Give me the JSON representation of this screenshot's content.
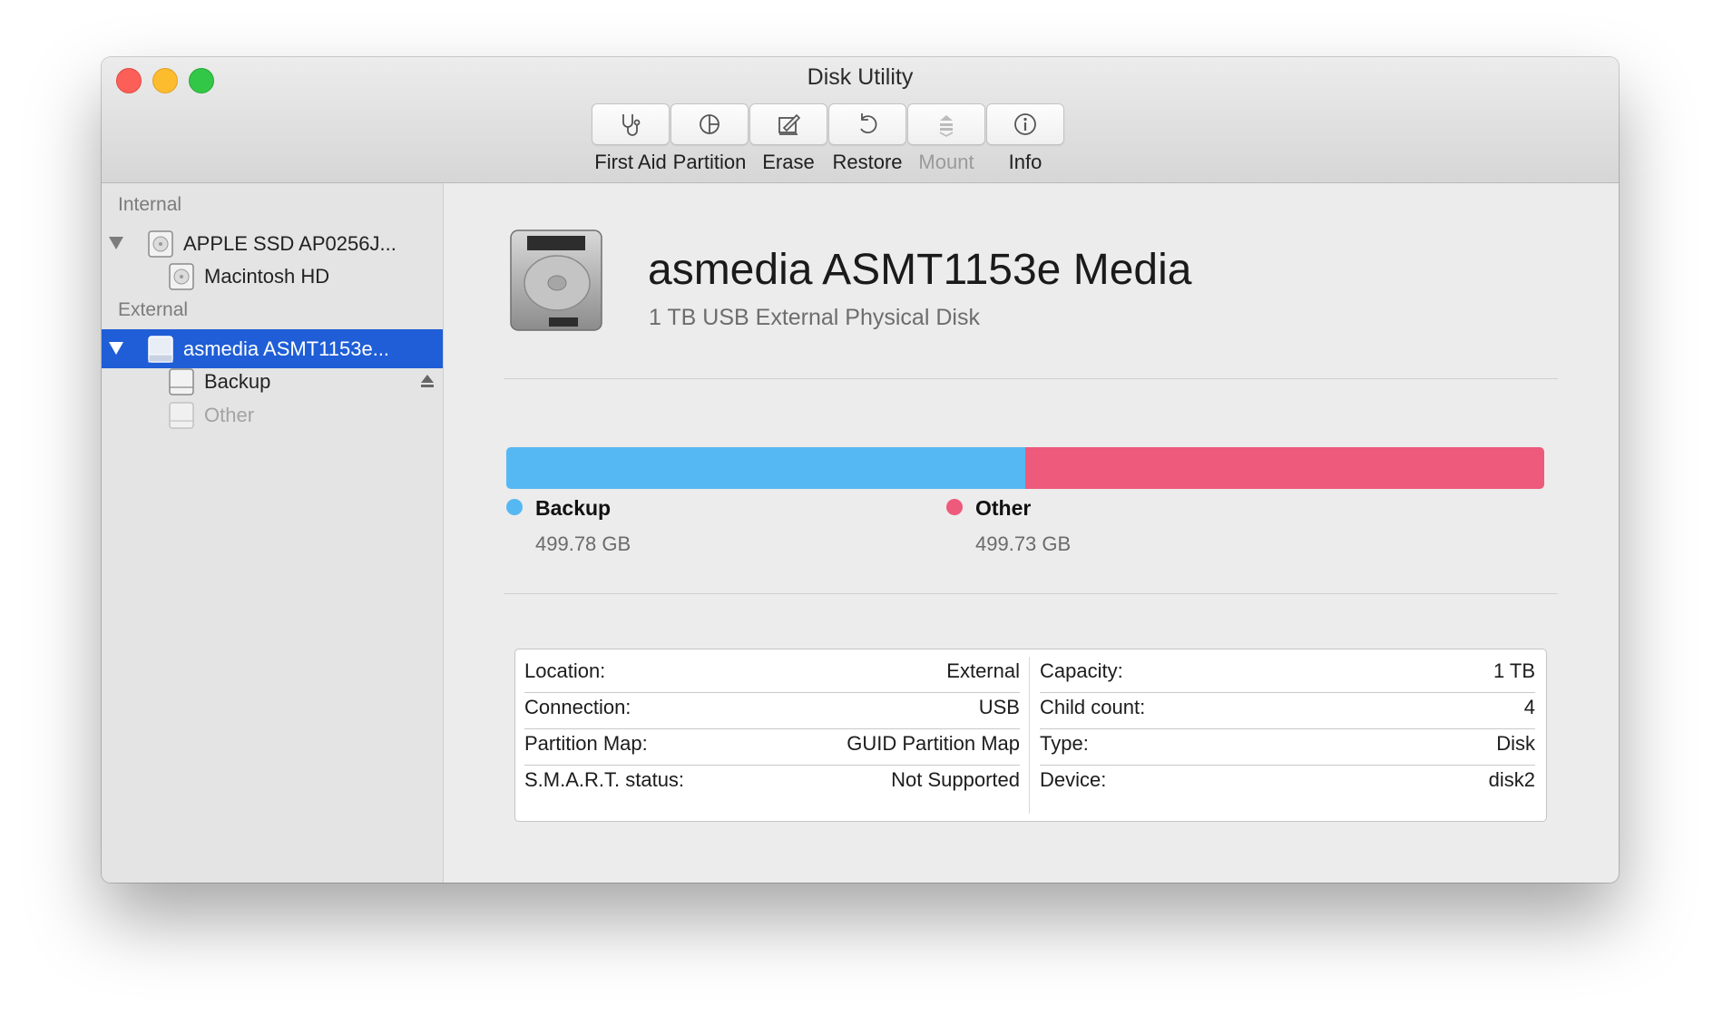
{
  "window": {
    "title": "Disk Utility"
  },
  "toolbar": {
    "buttons": [
      {
        "label": "First Aid",
        "icon": "stethoscope-icon",
        "enabled": true
      },
      {
        "label": "Partition",
        "icon": "pie-chart-icon",
        "enabled": true
      },
      {
        "label": "Erase",
        "icon": "erase-icon",
        "enabled": true
      },
      {
        "label": "Restore",
        "icon": "restore-arrow-icon",
        "enabled": true
      },
      {
        "label": "Mount",
        "icon": "mount-icon",
        "enabled": false
      },
      {
        "label": "Info",
        "icon": "info-icon",
        "enabled": true
      }
    ]
  },
  "sidebar": {
    "internal_header": "Internal",
    "external_header": "External",
    "internal_items": [
      {
        "label": "APPLE SSD AP0256J...",
        "level": 0,
        "expanded": true,
        "icon": "internal-disk-icon"
      },
      {
        "label": "Macintosh HD",
        "level": 1,
        "icon": "internal-volume-icon"
      }
    ],
    "external_items": [
      {
        "label": "asmedia ASMT1153e...",
        "level": 0,
        "expanded": true,
        "selected": true,
        "icon": "external-disk-icon"
      },
      {
        "label": "Backup",
        "level": 1,
        "mounted": true,
        "icon": "external-volume-icon"
      },
      {
        "label": "Other",
        "level": 1,
        "mounted": false,
        "icon": "external-volume-icon"
      }
    ]
  },
  "device": {
    "name": "asmedia ASMT1153e Media",
    "subtitle": "1 TB USB External Physical Disk"
  },
  "partitions": [
    {
      "name": "Backup",
      "size": "499.78 GB",
      "color": "#56b8f2",
      "share": 0.5
    },
    {
      "name": "Other",
      "size": "499.73 GB",
      "color": "#ee5a7b",
      "share": 0.5
    }
  ],
  "info": {
    "left": [
      {
        "key": "Location:",
        "value": "External"
      },
      {
        "key": "Connection:",
        "value": "USB"
      },
      {
        "key": "Partition Map:",
        "value": "GUID Partition Map"
      },
      {
        "key": "S.M.A.R.T. status:",
        "value": "Not Supported"
      }
    ],
    "right": [
      {
        "key": "Capacity:",
        "value": "1 TB"
      },
      {
        "key": "Child count:",
        "value": "4"
      },
      {
        "key": "Type:",
        "value": "Disk"
      },
      {
        "key": "Device:",
        "value": "disk2"
      }
    ]
  },
  "colors": {
    "selection": "#1f5ed6",
    "backup": "#56b8f2",
    "other": "#ee5a7b"
  }
}
